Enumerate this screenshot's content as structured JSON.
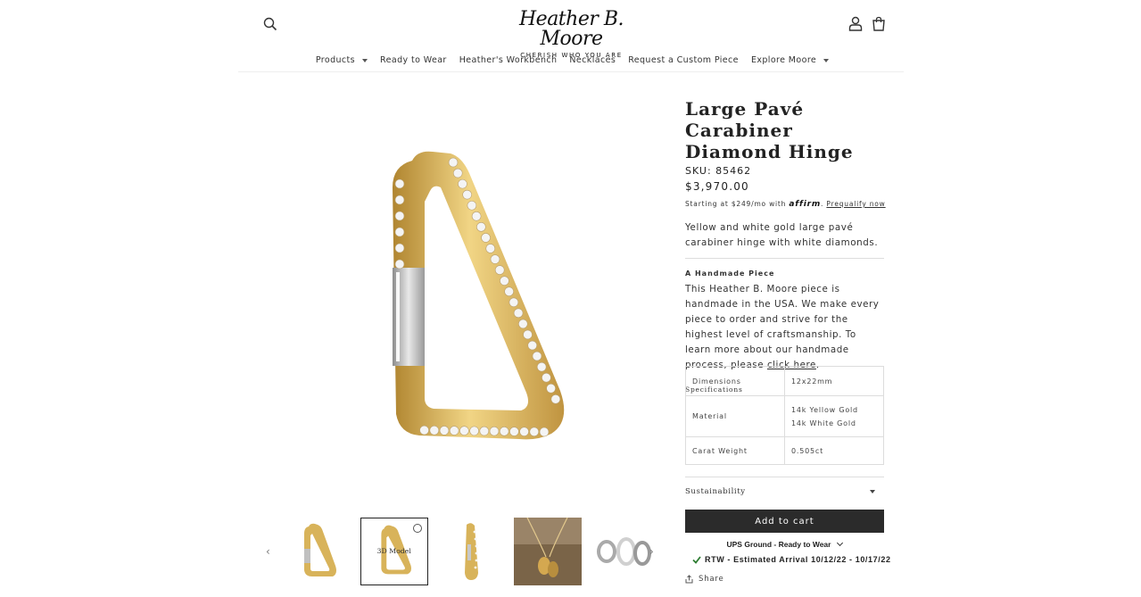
{
  "brand": {
    "logo_script": "Heather B. Moore",
    "tagline": "CHERISH WHO YOU ARE"
  },
  "nav": {
    "items": [
      {
        "label": "Products",
        "has_dropdown": true
      },
      {
        "label": "Ready to Wear",
        "has_dropdown": false
      },
      {
        "label": "Heather's Workbench",
        "has_dropdown": false
      },
      {
        "label": "Necklaces",
        "has_dropdown": false
      },
      {
        "label": "Request a Custom Piece",
        "has_dropdown": false
      },
      {
        "label": "Explore Moore",
        "has_dropdown": true
      }
    ]
  },
  "icons": {
    "search": "search-icon",
    "account": "account-icon",
    "cart": "cart-icon"
  },
  "product": {
    "title": "Large Pavé Carabiner Diamond Hinge",
    "sku": "SKU: 85462",
    "price": "$3,970.00",
    "affirm_prefix": "Starting at $249/mo with",
    "affirm_brand": "affirm",
    "affirm_link": "Prequalify now",
    "description": "Yellow and white gold large pavé carabiner hinge with white diamonds.",
    "handmade_heading": "A Handmade Piece",
    "handmade_body": "This Heather B. Moore piece is handmade in the USA. We make every piece to order and strive for the highest level of craftsmanship. To learn more about our handmade process, please ",
    "handmade_link": "click here",
    "handmade_end": ".",
    "specifications_heading": "Specifications",
    "specifications": [
      {
        "label": "Dimensions",
        "value": "12x22mm",
        "value2": ""
      },
      {
        "label": "Material",
        "value": "14k Yellow Gold",
        "value2": "14k White Gold"
      },
      {
        "label": "Carat Weight",
        "value": "0.505ct",
        "value2": ""
      }
    ],
    "sustainability_label": "Sustainability",
    "add_to_cart": "Add to cart",
    "shipping_option": "UPS Ground - Ready to Wear",
    "eta": "RTW - Estimated Arrival 10/12/22 - 10/17/22",
    "share": "Share"
  },
  "gallery": {
    "thumbnail_count": 5,
    "active_index": 1,
    "thumb_model_label": "3D Model"
  },
  "colors": {
    "gold": "#d8b35a",
    "gold_dark": "#b38a33",
    "button": "#2b2b2b",
    "check_green": "#2e7d32"
  }
}
